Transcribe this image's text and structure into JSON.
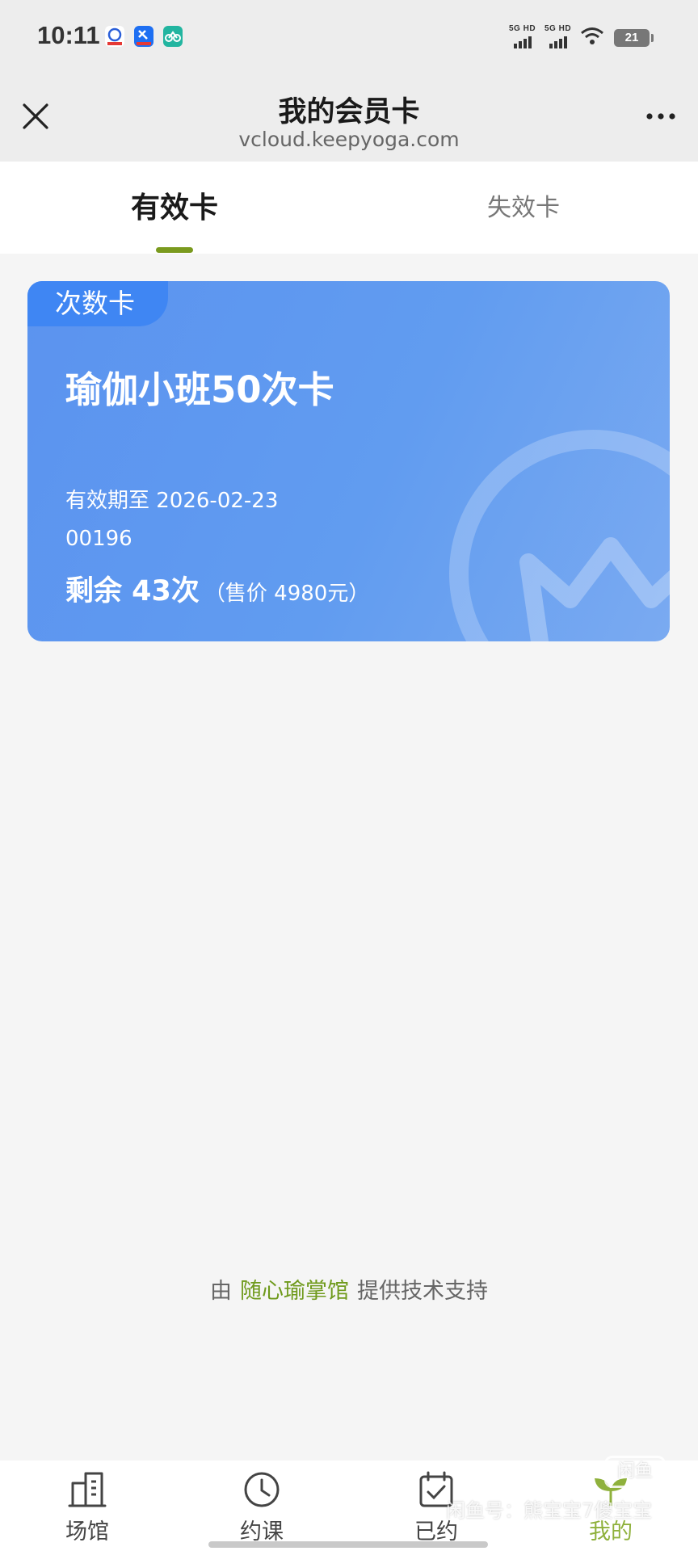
{
  "status_bar": {
    "time": "10:11",
    "signal_1_label": "5G HD",
    "signal_2_label": "5G HD",
    "battery_level": "21",
    "app_icons": [
      "baidu-icon",
      "eleme-icon",
      "bike-icon"
    ]
  },
  "header": {
    "title": "我的会员卡",
    "subtitle": "vcloud.keepyoga.com"
  },
  "tabs": [
    {
      "label": "有效卡",
      "active": true
    },
    {
      "label": "失效卡",
      "active": false
    }
  ],
  "card": {
    "type_badge": "次数卡",
    "name": "瑜伽小班50次卡",
    "expiry": "有效期至 2026-02-23",
    "number": "00196",
    "remaining": "剩余 43次",
    "price": "（售价 4980元）"
  },
  "footer": {
    "prefix": "由",
    "brand": "随心瑜掌馆",
    "suffix": "提供技术支持"
  },
  "bottom_nav": [
    {
      "label": "场馆",
      "icon": "building-icon",
      "active": false
    },
    {
      "label": "约课",
      "icon": "clock-icon",
      "active": false
    },
    {
      "label": "已约",
      "icon": "calendar-check-icon",
      "active": false
    },
    {
      "label": "我的",
      "icon": "leaf-icon",
      "active": true
    }
  ],
  "watermark": {
    "text": "闲鱼号：熊宝宝7傻宝宝",
    "logo": "闲鱼"
  },
  "colors": {
    "accent": "#7a9a1e",
    "card_blue": "#5b93ef",
    "badge_blue": "#3f86f3",
    "nav_active": "#8fb13c"
  }
}
